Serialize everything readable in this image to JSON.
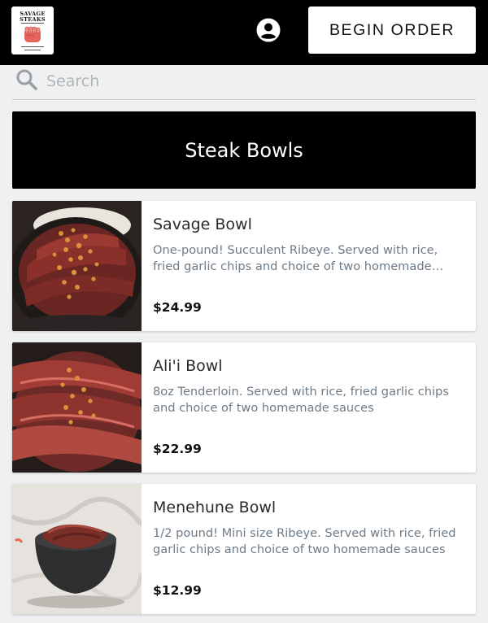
{
  "header": {
    "logo_line1": "SAVAGE",
    "logo_line2": "STEAKS",
    "begin_order_label": "BEGIN ORDER"
  },
  "search": {
    "placeholder": "Search"
  },
  "category": {
    "title": "Steak Bowls"
  },
  "items": [
    {
      "name": "Savage Bowl",
      "description": "One-pound! Succulent Ribeye. Served with rice, fried garlic chips and choice of two homemade…",
      "price": "$24.99"
    },
    {
      "name": "Ali'i Bowl",
      "description": "8oz Tenderloin. Served with rice, fried garlic chips and choice of two homemade sauces",
      "price": "$22.99"
    },
    {
      "name": "Menehune Bowl",
      "description": "1/2 pound! Mini size Ribeye. Served with rice, fried garlic chips and choice of two homemade sauces",
      "price": "$12.99"
    }
  ],
  "colors": {
    "topbar": "#000000",
    "background": "#eef0f1",
    "description_text": "#6e7b86",
    "fist": "#e8635a"
  },
  "icons": {
    "account": "account-circle-icon",
    "search": "search-icon",
    "logo": "fist-icon"
  }
}
